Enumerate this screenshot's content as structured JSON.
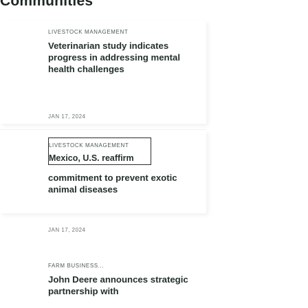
{
  "section": {
    "title": "Communities"
  },
  "articles": [
    {
      "category": "LIVESTOCK MANAGEMENT",
      "headline": "Veterinarian study indicates progress in addressing mental health challenges",
      "date": "JAN 17, 2024"
    },
    {
      "category": "LIVESTOCK MANAGEMENT",
      "headline_overlay": "Mexico, U.S. reaffirm",
      "headline": "commitment to prevent exotic animal diseases",
      "date": "JAN 17, 2024"
    },
    {
      "category": "FARM BUSINESS...",
      "headline": "John Deere announces strategic partnership with"
    }
  ]
}
